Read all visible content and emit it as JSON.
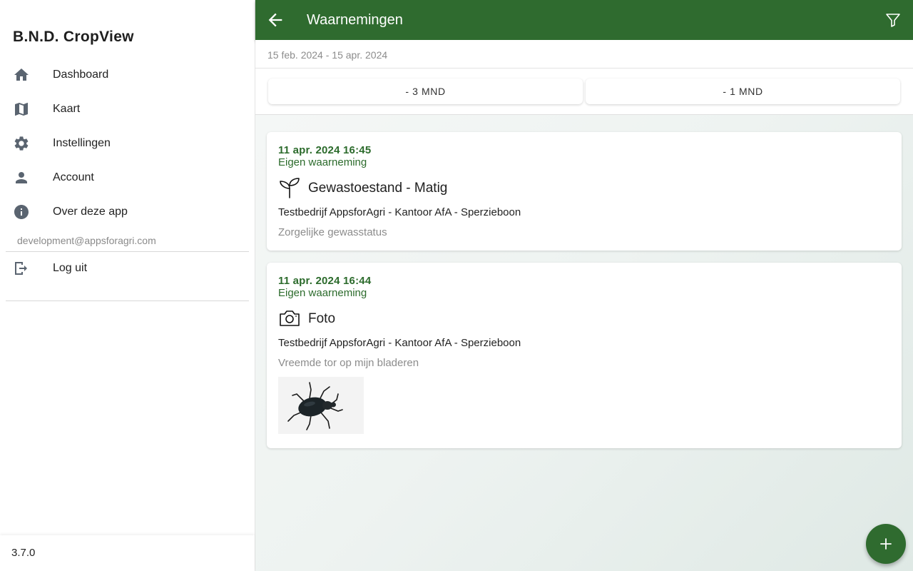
{
  "sidebar": {
    "app_title": "B.N.D. CropView",
    "items": [
      {
        "label": "Dashboard",
        "icon": "home-icon"
      },
      {
        "label": "Kaart",
        "icon": "map-icon"
      },
      {
        "label": "Instellingen",
        "icon": "gear-icon"
      },
      {
        "label": "Account",
        "icon": "person-icon"
      },
      {
        "label": "Over deze app",
        "icon": "info-icon"
      }
    ],
    "email": "development@appsforagri.com",
    "logout": {
      "label": "Log uit",
      "icon": "logout-icon"
    },
    "version": "3.7.0"
  },
  "header": {
    "title": "Waarnemingen",
    "back_icon": "arrow-left-icon",
    "filter_icon": "filter-icon",
    "bar_color": "#2f6b2f"
  },
  "filters": {
    "date_range": "15 feb. 2024 - 15 apr. 2024",
    "buttons": [
      "- 3 MND",
      "- 1 MND"
    ]
  },
  "observations": [
    {
      "datetime": "11 apr. 2024 16:45",
      "source": "Eigen waarneming",
      "type_icon": "sprout-icon",
      "type": "Gewastoestand - Matig",
      "location": "Testbedrijf AppsforAgri - Kantoor AfA - Sperzieboon",
      "note": "Zorgelijke gewasstatus"
    },
    {
      "datetime": "11 apr. 2024 16:44",
      "source": "Eigen waarneming",
      "type_icon": "camera-icon",
      "type": "Foto",
      "location": "Testbedrijf AppsforAgri - Kantoor AfA - Sperzieboon",
      "note": "Vreemde tor op mijn bladeren",
      "photo": "beetle-photo"
    }
  ],
  "fab": {
    "icon": "plus-icon"
  },
  "colors": {
    "primary": "#2f6b2f",
    "accent_text": "#2c6b2c",
    "muted_text": "#8c8c8c"
  }
}
